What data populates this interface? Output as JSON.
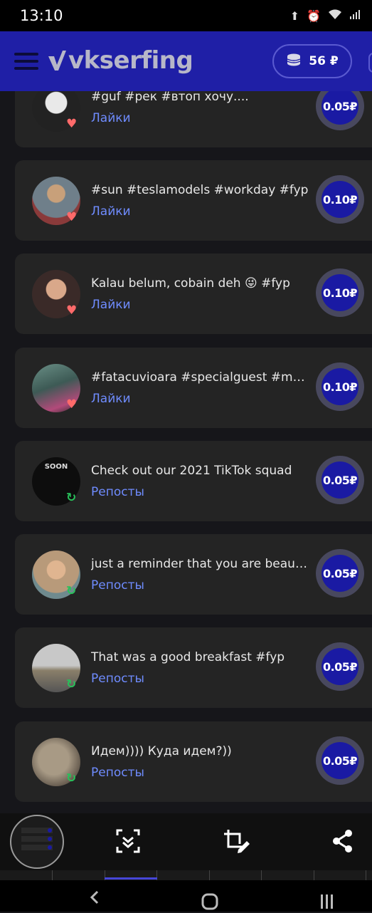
{
  "status_bar": {
    "time": "13:10",
    "icons": [
      "upload-icon",
      "alarm-icon",
      "wifi-icon",
      "signal-icon"
    ]
  },
  "app_bar": {
    "logo_text": "vkserfing",
    "balance": "56 ₽",
    "colors": {
      "bar": "#1f1fa6",
      "accent": "#6f8cff"
    }
  },
  "tasks": [
    {
      "title": "#guf #рек #втоп хочу....",
      "type": "Лайки",
      "price": "0.05₽",
      "badge": "heart-icon"
    },
    {
      "title": "#sun #teslamodels #workday #fyp",
      "type": "Лайки",
      "price": "0.10₽",
      "badge": "heart-icon"
    },
    {
      "title": "Kalau belum, cobain deh 😜 #fyp",
      "type": "Лайки",
      "price": "0.10₽",
      "badge": "heart-icon"
    },
    {
      "title": "#fatacuvioara #specialguest #music",
      "type": "Лайки",
      "price": "0.10₽",
      "badge": "heart-icon"
    },
    {
      "title": "Check out our 2021 TikTok squad",
      "type": "Репосты",
      "price": "0.05₽",
      "badge": "repost-icon"
    },
    {
      "title": "just a reminder that you are beautiful",
      "type": "Репосты",
      "price": "0.05₽",
      "badge": "repost-icon"
    },
    {
      "title": "That was a good breakfast #fyp",
      "type": "Репосты",
      "price": "0.05₽",
      "badge": "repost-icon"
    },
    {
      "title": "Идем)))) Куда идем?))",
      "type": "Репосты",
      "price": "0.05₽",
      "badge": "repost-icon"
    }
  ],
  "avatar_texts": {
    "task5": "SOON"
  },
  "screenshot_toolbar": {
    "tools": [
      "scroll-capture-icon",
      "crop-edit-icon",
      "share-icon"
    ]
  },
  "nav_bar": {
    "buttons": [
      "back-icon",
      "home-icon",
      "recents-icon"
    ]
  }
}
